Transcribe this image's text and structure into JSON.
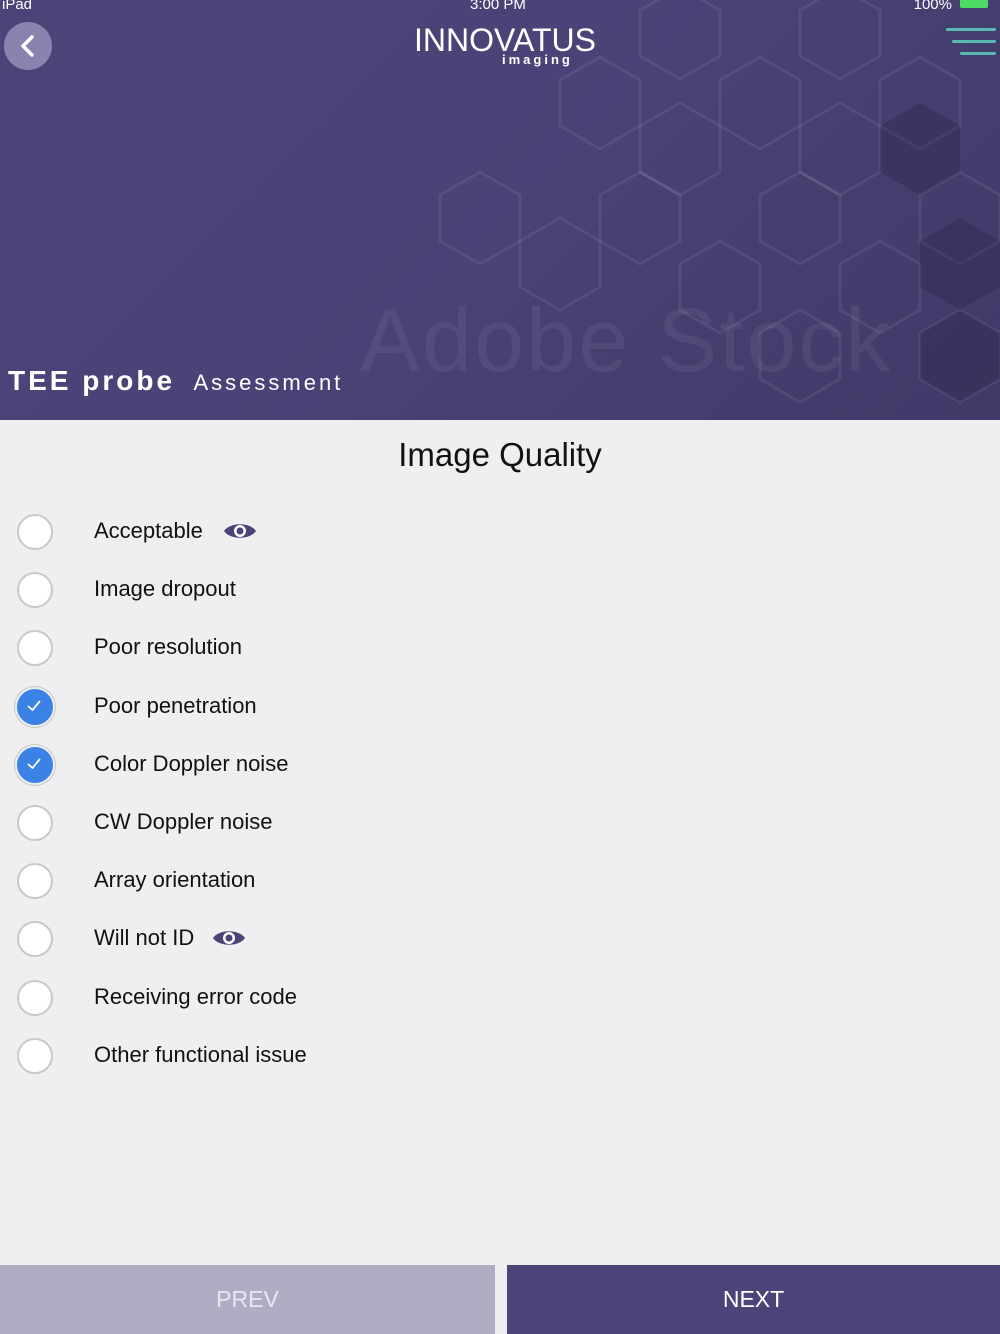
{
  "status_bar": {
    "device": "iPad",
    "time": "3:00 PM",
    "battery": "100%"
  },
  "header": {
    "logo_main": "INNOVATUS",
    "logo_sub": "imaging",
    "title_bold": "TEE probe",
    "title_light": "Assessment",
    "watermark": "Adobe Stock"
  },
  "section_title": "Image Quality",
  "options": [
    {
      "label": "Acceptable",
      "checked": false,
      "has_eye": true
    },
    {
      "label": "Image dropout",
      "checked": false,
      "has_eye": false
    },
    {
      "label": "Poor resolution",
      "checked": false,
      "has_eye": false
    },
    {
      "label": "Poor penetration",
      "checked": true,
      "has_eye": false
    },
    {
      "label": "Color Doppler noise",
      "checked": true,
      "has_eye": false
    },
    {
      "label": "CW Doppler noise",
      "checked": false,
      "has_eye": false
    },
    {
      "label": "Array orientation",
      "checked": false,
      "has_eye": false
    },
    {
      "label": "Will not ID",
      "checked": false,
      "has_eye": true
    },
    {
      "label": "Receiving error code",
      "checked": false,
      "has_eye": false
    },
    {
      "label": "Other functional issue",
      "checked": false,
      "has_eye": false
    }
  ],
  "footer": {
    "prev_label": "PREV",
    "next_label": "NEXT"
  },
  "colors": {
    "header_bg": "#4b4478",
    "accent_blue": "#3b82e6",
    "menu_teal": "#5ab9b3",
    "prev_bg": "#afadc4"
  },
  "icons": {
    "back": "chevron-left-icon",
    "menu": "hamburger-menu-icon",
    "eye": "eye-icon",
    "check": "checkmark-icon"
  }
}
